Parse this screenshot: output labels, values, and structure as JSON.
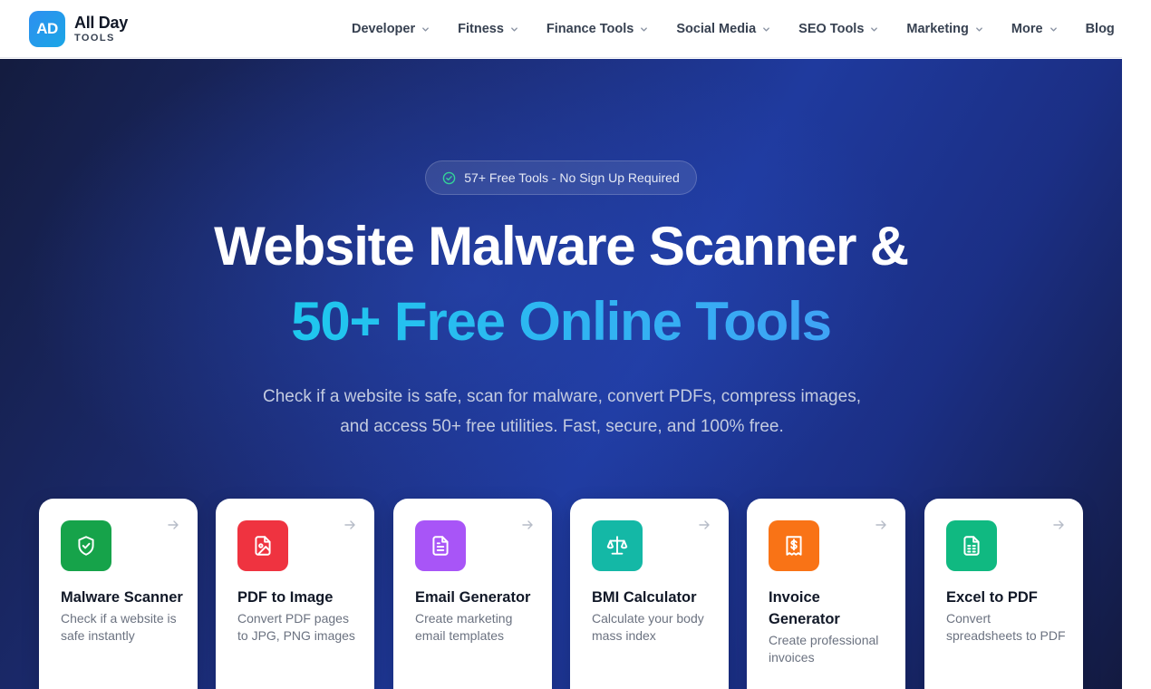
{
  "brand": {
    "badge": "AD",
    "name": "All Day",
    "sub": "TOOLS"
  },
  "nav": {
    "items": [
      {
        "label": "Developer",
        "dropdown": true
      },
      {
        "label": "Fitness",
        "dropdown": true
      },
      {
        "label": "Finance Tools",
        "dropdown": true
      },
      {
        "label": "Social Media",
        "dropdown": true
      },
      {
        "label": "SEO Tools",
        "dropdown": true
      },
      {
        "label": "Marketing",
        "dropdown": true
      },
      {
        "label": "More",
        "dropdown": true
      },
      {
        "label": "Blog",
        "dropdown": false
      }
    ]
  },
  "hero": {
    "pill": "57+ Free Tools - No Sign Up Required",
    "title_line1": "Website Malware Scanner &",
    "title_line2": "50+ Free Online Tools",
    "subtitle": "Check if a website is safe, scan for malware, convert PDFs, compress images, and access 50+ free utilities. Fast, secure, and 100% free."
  },
  "cards": [
    {
      "title": "Malware Scanner",
      "desc": "Check if a website is safe instantly",
      "icon": "shield-check-icon",
      "color": "#16a34a"
    },
    {
      "title": "PDF to Image",
      "desc": "Convert PDF pages to JPG, PNG images",
      "icon": "file-image-icon",
      "color": "#ef3340"
    },
    {
      "title": "Email Generator",
      "desc": "Create marketing email templates",
      "icon": "file-text-icon",
      "color": "#a855f7"
    },
    {
      "title": "BMI Calculator",
      "desc": "Calculate your body mass index",
      "icon": "scale-icon",
      "color": "#14b8a6"
    },
    {
      "title": "Invoice Generator",
      "desc": "Create professional invoices",
      "icon": "receipt-icon",
      "color": "#f97316"
    },
    {
      "title": "Excel to PDF",
      "desc": "Convert spreadsheets to PDF",
      "icon": "spreadsheet-icon",
      "color": "#10b981"
    }
  ]
}
